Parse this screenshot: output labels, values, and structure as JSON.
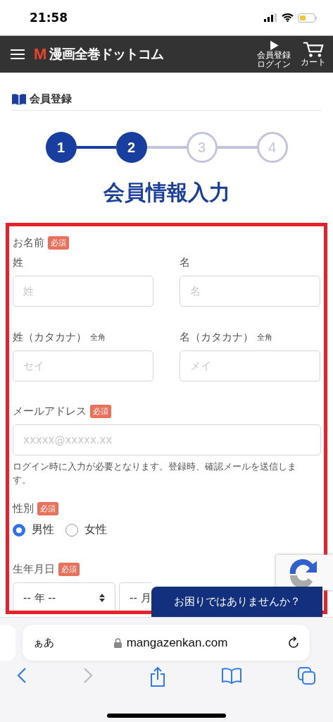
{
  "status_bar": {
    "time": "21:58"
  },
  "header": {
    "logo_mark": "M",
    "logo_text": "漫画全巻ドットコム",
    "actions": [
      {
        "kind": "login",
        "label_lines": [
          "会員登録",
          "ログイン"
        ]
      },
      {
        "kind": "cart",
        "label_lines": [
          "カート"
        ]
      }
    ]
  },
  "section_title": "会員登録",
  "steps": [
    {
      "number": "1",
      "done": true
    },
    {
      "number": "2",
      "done": true
    },
    {
      "number": "3",
      "done": false
    },
    {
      "number": "4",
      "done": false
    }
  ],
  "heading": "会員情報入力",
  "form": {
    "name_group": {
      "label": "お名前",
      "badge": "必須",
      "fields": [
        {
          "label": "姓",
          "placeholder": "姓"
        },
        {
          "label": "名",
          "placeholder": "名"
        }
      ]
    },
    "kana_group": {
      "fields": [
        {
          "label": "姓（カタカナ）",
          "note": "全角",
          "placeholder": "セイ"
        },
        {
          "label": "名（カタカナ）",
          "note": "全角",
          "placeholder": "メイ"
        }
      ]
    },
    "email": {
      "label": "メールアドレス",
      "badge": "必須",
      "placeholder": "xxxxx@xxxxx.xx",
      "hint": "ログイン時に入力が必要となります。登録時、確認メールを送信します。"
    },
    "gender": {
      "label": "性別",
      "badge": "必須",
      "options": [
        {
          "label": "男性",
          "selected": true
        },
        {
          "label": "女性",
          "selected": false
        }
      ]
    },
    "birthday": {
      "label": "生年月日",
      "badge": "必須",
      "selects": [
        {
          "value": "-- 年 --"
        },
        {
          "value": "-- 月"
        }
      ]
    }
  },
  "help_button": "お困りではありませんか？",
  "browser": {
    "text_size": "ぁあ",
    "url": "mangazenkan.com"
  }
}
